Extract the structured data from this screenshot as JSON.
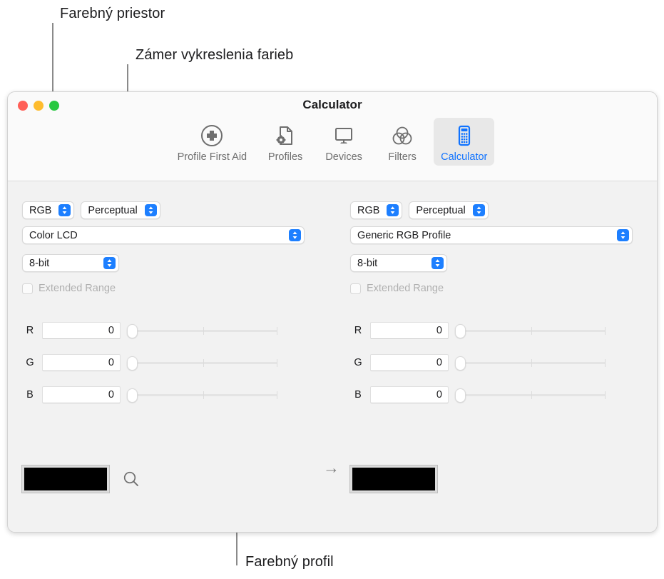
{
  "annotations": [
    {
      "id": "color-space",
      "label": "Farebný priestor"
    },
    {
      "id": "render-intent",
      "label": "Zámer vykreslenia farieb"
    },
    {
      "id": "color-profile",
      "label": "Farebný profil"
    }
  ],
  "window": {
    "title": "Calculator",
    "traffic_lights": [
      {
        "name": "close",
        "color": "#ff5f57"
      },
      {
        "name": "minimize",
        "color": "#febc2e"
      },
      {
        "name": "zoom",
        "color": "#28c840"
      }
    ],
    "toolbar": {
      "items": [
        {
          "label": "Profile First Aid",
          "icon": "circle-plus-icon",
          "selected": false
        },
        {
          "label": "Profiles",
          "icon": "document-gear-icon",
          "selected": false
        },
        {
          "label": "Devices",
          "icon": "display-icon",
          "selected": false
        },
        {
          "label": "Filters",
          "icon": "venn-circles-icon",
          "selected": false
        },
        {
          "label": "Calculator",
          "icon": "calculator-icon",
          "selected": true
        }
      ],
      "selected_color": "#1073ff",
      "label_color": "#6e6e6e"
    }
  },
  "panels": {
    "left": {
      "color_space": "RGB",
      "rendering_intent": "Perceptual",
      "profile": "Color LCD",
      "bit_depth": "8-bit",
      "extended_range_label": "Extended Range",
      "extended_range_checked": false,
      "channels": [
        {
          "name": "R",
          "value": "0"
        },
        {
          "name": "G",
          "value": "0"
        },
        {
          "name": "B",
          "value": "0"
        }
      ],
      "swatch_color": "#000000",
      "has_loupe": true
    },
    "right": {
      "color_space": "RGB",
      "rendering_intent": "Perceptual",
      "profile": "Generic RGB Profile",
      "bit_depth": "8-bit",
      "extended_range_label": "Extended Range",
      "extended_range_checked": false,
      "channels": [
        {
          "name": "R",
          "value": "0"
        },
        {
          "name": "G",
          "value": "0"
        },
        {
          "name": "B",
          "value": "0"
        }
      ],
      "swatch_color": "#000000",
      "has_loupe": false
    }
  },
  "conversion_arrow": "→"
}
